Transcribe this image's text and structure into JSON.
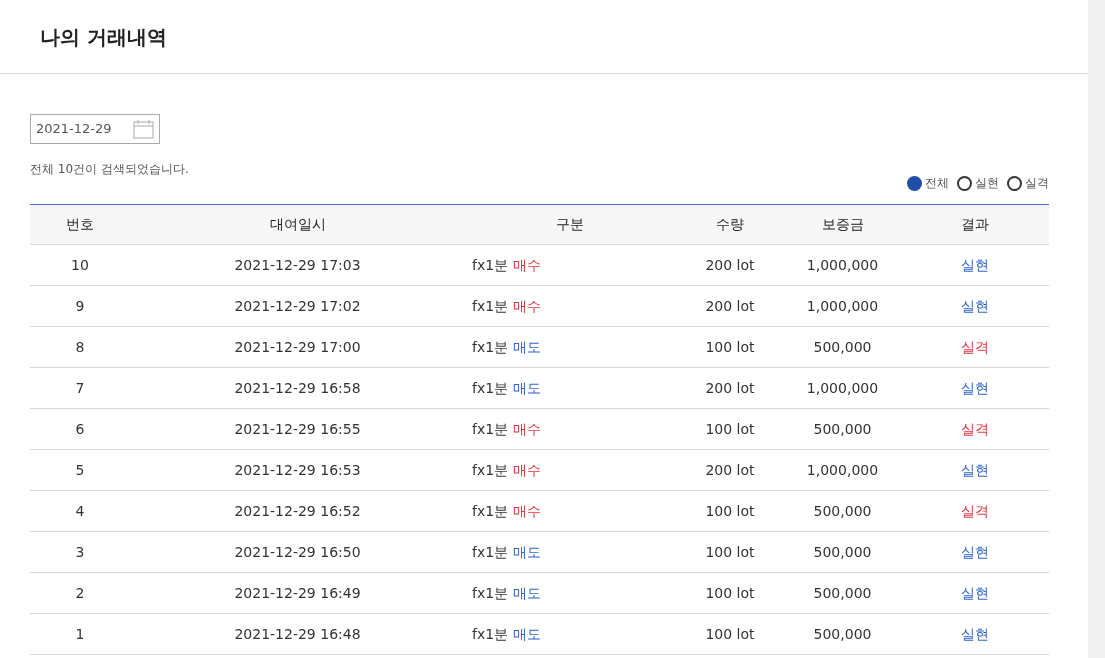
{
  "page": {
    "title": "나의 거래내역"
  },
  "date_field": {
    "value": "2021-12-29"
  },
  "result_count": "전체 10건이 검색되었습니다.",
  "filters": [
    {
      "label": "전체",
      "selected": true
    },
    {
      "label": "실현",
      "selected": false
    },
    {
      "label": "실격",
      "selected": false
    }
  ],
  "table": {
    "columns": [
      "번호",
      "대여일시",
      "구분",
      "수량",
      "보증금",
      "결과"
    ],
    "rows": [
      {
        "no": "10",
        "datetime": "2021-12-29 17:03",
        "product": "fx1분",
        "side": {
          "text": "매수",
          "kind": "buy"
        },
        "quantity": "200 lot",
        "deposit": "1,000,000",
        "result": {
          "text": "실현",
          "kind": "realized"
        }
      },
      {
        "no": "9",
        "datetime": "2021-12-29 17:02",
        "product": "fx1분",
        "side": {
          "text": "매수",
          "kind": "buy"
        },
        "quantity": "200 lot",
        "deposit": "1,000,000",
        "result": {
          "text": "실현",
          "kind": "realized"
        }
      },
      {
        "no": "8",
        "datetime": "2021-12-29 17:00",
        "product": "fx1분",
        "side": {
          "text": "매도",
          "kind": "sell"
        },
        "quantity": "100 lot",
        "deposit": "500,000",
        "result": {
          "text": "실격",
          "kind": "failed"
        }
      },
      {
        "no": "7",
        "datetime": "2021-12-29 16:58",
        "product": "fx1분",
        "side": {
          "text": "매도",
          "kind": "sell"
        },
        "quantity": "200 lot",
        "deposit": "1,000,000",
        "result": {
          "text": "실현",
          "kind": "realized"
        }
      },
      {
        "no": "6",
        "datetime": "2021-12-29 16:55",
        "product": "fx1분",
        "side": {
          "text": "매수",
          "kind": "buy"
        },
        "quantity": "100 lot",
        "deposit": "500,000",
        "result": {
          "text": "실격",
          "kind": "failed"
        }
      },
      {
        "no": "5",
        "datetime": "2021-12-29 16:53",
        "product": "fx1분",
        "side": {
          "text": "매수",
          "kind": "buy"
        },
        "quantity": "200 lot",
        "deposit": "1,000,000",
        "result": {
          "text": "실현",
          "kind": "realized"
        }
      },
      {
        "no": "4",
        "datetime": "2021-12-29 16:52",
        "product": "fx1분",
        "side": {
          "text": "매수",
          "kind": "buy"
        },
        "quantity": "100 lot",
        "deposit": "500,000",
        "result": {
          "text": "실격",
          "kind": "failed"
        }
      },
      {
        "no": "3",
        "datetime": "2021-12-29 16:50",
        "product": "fx1분",
        "side": {
          "text": "매도",
          "kind": "sell"
        },
        "quantity": "100 lot",
        "deposit": "500,000",
        "result": {
          "text": "실현",
          "kind": "realized"
        }
      },
      {
        "no": "2",
        "datetime": "2021-12-29 16:49",
        "product": "fx1분",
        "side": {
          "text": "매도",
          "kind": "sell"
        },
        "quantity": "100 lot",
        "deposit": "500,000",
        "result": {
          "text": "실현",
          "kind": "realized"
        }
      },
      {
        "no": "1",
        "datetime": "2021-12-29 16:48",
        "product": "fx1분",
        "side": {
          "text": "매도",
          "kind": "sell"
        },
        "quantity": "100 lot",
        "deposit": "500,000",
        "result": {
          "text": "실현",
          "kind": "realized"
        }
      }
    ]
  }
}
